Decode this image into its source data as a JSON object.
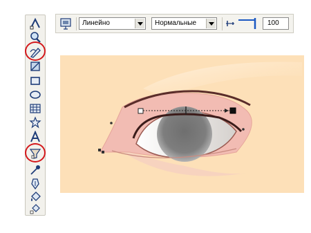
{
  "toolbox": {
    "tools": [
      {
        "name": "shape-tool-icon"
      },
      {
        "name": "zoom-tool-icon"
      },
      {
        "name": "freehand-tool-icon",
        "highlighted": true
      },
      {
        "name": "smart-fill-tool-icon"
      },
      {
        "name": "rectangle-tool-icon"
      },
      {
        "name": "ellipse-tool-icon"
      },
      {
        "name": "polygon-tool-icon"
      },
      {
        "name": "star-tool-icon"
      },
      {
        "name": "text-tool-icon"
      },
      {
        "name": "interactive-transparency-tool-icon",
        "highlighted": true
      },
      {
        "name": "eyedropper-tool-icon"
      },
      {
        "name": "outline-tool-icon"
      },
      {
        "name": "fill-tool-icon"
      },
      {
        "name": "interactive-fill-tool-icon"
      }
    ]
  },
  "propbar": {
    "transparency_type": "Линейно",
    "merge_mode": "Нормальные",
    "transparency_value": "100"
  },
  "colors": {
    "canvas_bg": "#fde0b8",
    "highlight_ring": "#d4181c",
    "iris": "#7a7a7a",
    "lid_pink": "#f2b8b0"
  }
}
